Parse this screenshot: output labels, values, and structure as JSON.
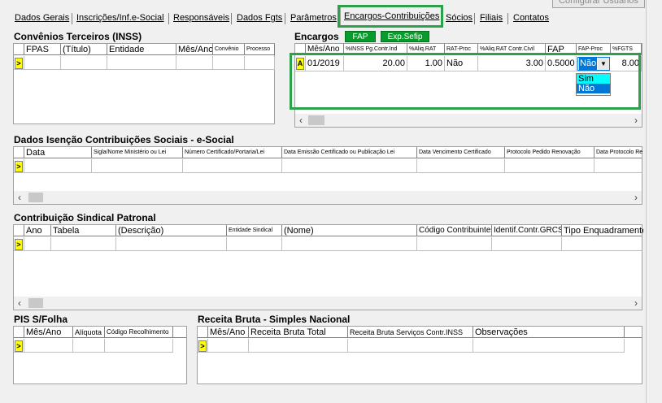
{
  "header": {
    "config_button": "Configurar Usuários"
  },
  "tabs": [
    {
      "label": "Dados Gerais"
    },
    {
      "label": "Inscrições/Inf.e-Social"
    },
    {
      "label": "Responsáveis"
    },
    {
      "label": "Dados Fgts"
    },
    {
      "label": "Parâmetros"
    },
    {
      "label": "Encargos-Contribuições"
    },
    {
      "label": "Sócios"
    },
    {
      "label": "Filiais"
    },
    {
      "label": "Contatos"
    }
  ],
  "convenios": {
    "title": "Convênios Terceiros (INSS)",
    "columns": [
      "FPAS",
      "(Título)",
      "Entidade",
      "Mês/Ano",
      "Convênio",
      "Processo"
    ]
  },
  "encargos": {
    "title": "Encargos",
    "fap_button": "FAP",
    "exp_button": "Exp.Sefip",
    "columns": [
      "Mês/Ano",
      "%INSS Pg.Contr.Ind",
      "%Aliq.RAT",
      "RAT-Proc",
      "%Aliq.RAT Contr.Civil",
      "FAP",
      "FAP-Proc",
      "%FGTS"
    ],
    "row": {
      "indicator": "A",
      "mes_ano": "01/2019",
      "inss": "20.00",
      "rat": "1.00",
      "rat_proc": "Não",
      "rat_civil": "3.00",
      "fap": "0.5000",
      "fap_proc": "Não",
      "fgts": "8.00"
    },
    "dropdown": [
      "Sim",
      "Não"
    ]
  },
  "isencao": {
    "title": "Dados Isenção Contribuições Sociais - e-Social",
    "columns": [
      "Data",
      "Sigla/Nome Ministério ou Lei",
      "Número Certificado/Portaria/Lei",
      "Data Emissão Certificado ou Publicação Lei",
      "Data Vencimento Certificado",
      "Protocolo Pedido Renovação",
      "Data Protocolo Re"
    ]
  },
  "sindical": {
    "title": "Contribuição Sindical Patronal",
    "columns": [
      "Ano",
      "Tabela",
      "(Descrição)",
      "Entidade Sindical",
      "(Nome)",
      "Código Contribuinte",
      "Identif.Contr.GRCS",
      "Tipo Enquadramente"
    ]
  },
  "pis": {
    "title": "PIS S/Folha",
    "columns": [
      "Mês/Ano",
      "Alíquota",
      "Código Recolhimento"
    ]
  },
  "receita": {
    "title": "Receita Bruta - Simples Nacional",
    "columns": [
      "Mês/Ano",
      "Receita Bruta Total",
      "Receita Bruta Serviços Contr.INSS",
      "Observações"
    ]
  },
  "row_indicator": ">",
  "colors": {
    "highlight": "#2ca04a",
    "button": "#079b2c",
    "indicator": "#ffff00",
    "selection": "#0078d7"
  }
}
